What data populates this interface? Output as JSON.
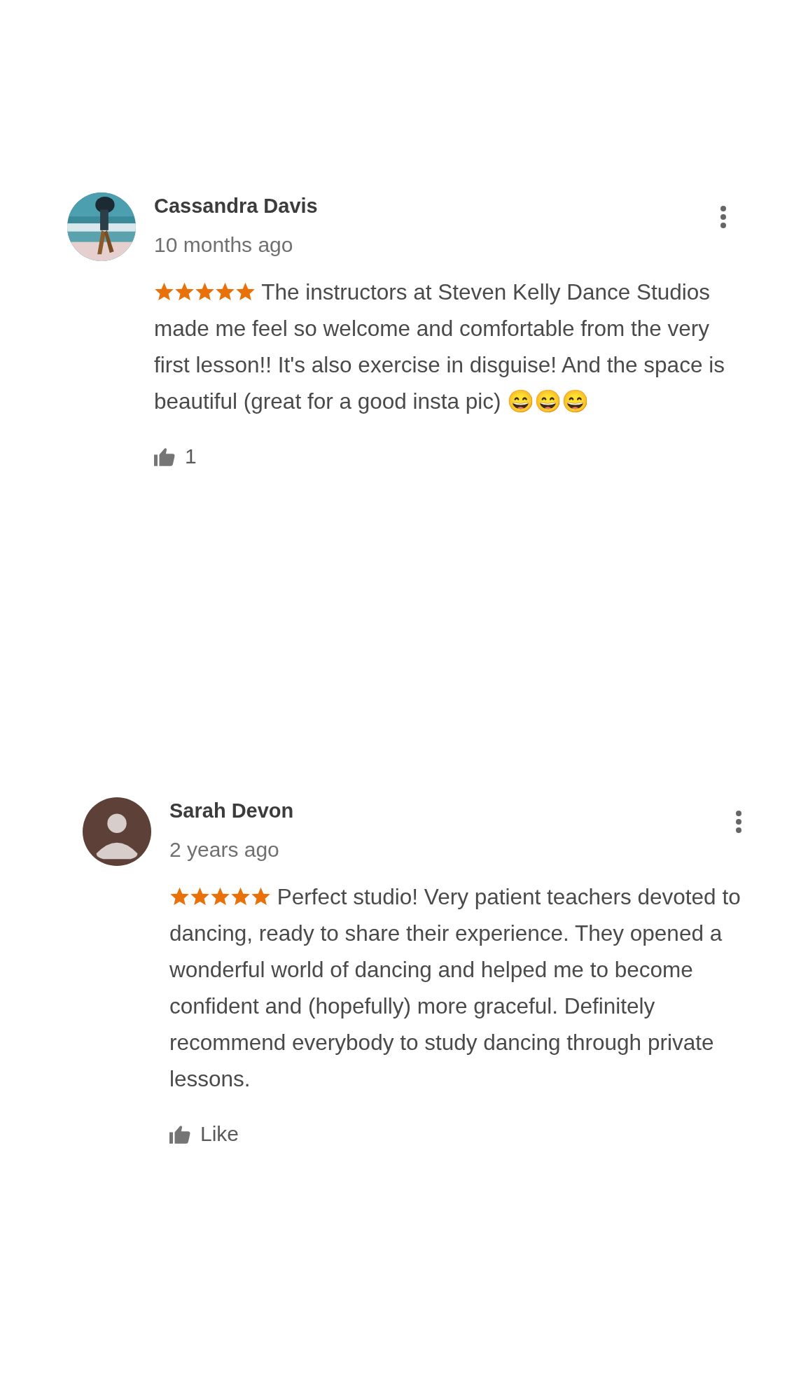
{
  "reviews": [
    {
      "name": "Cassandra Davis",
      "time": "10 months ago",
      "stars": 5,
      "text": "The instructors at Steven Kelly Dance Studios made me feel so welcome and comfortable from the very first lesson!! It's also exercise in disguise! And the space is beautiful (great for a good insta pic) 😄😄😄",
      "like": "1"
    },
    {
      "avatar": {
        "kind": "default"
      },
      "name": "Sarah Devon",
      "time": "2 years ago",
      "stars": 5,
      "text": "Perfect studio! Very patient teachers devoted to dancing, ready to share their experience. They opened a wonderful world of dancing and helped me to become confident and (hopefully) more graceful. Definitely\nrecommend everybody to study dancing through private lessons.",
      "like": "Like"
    }
  ]
}
